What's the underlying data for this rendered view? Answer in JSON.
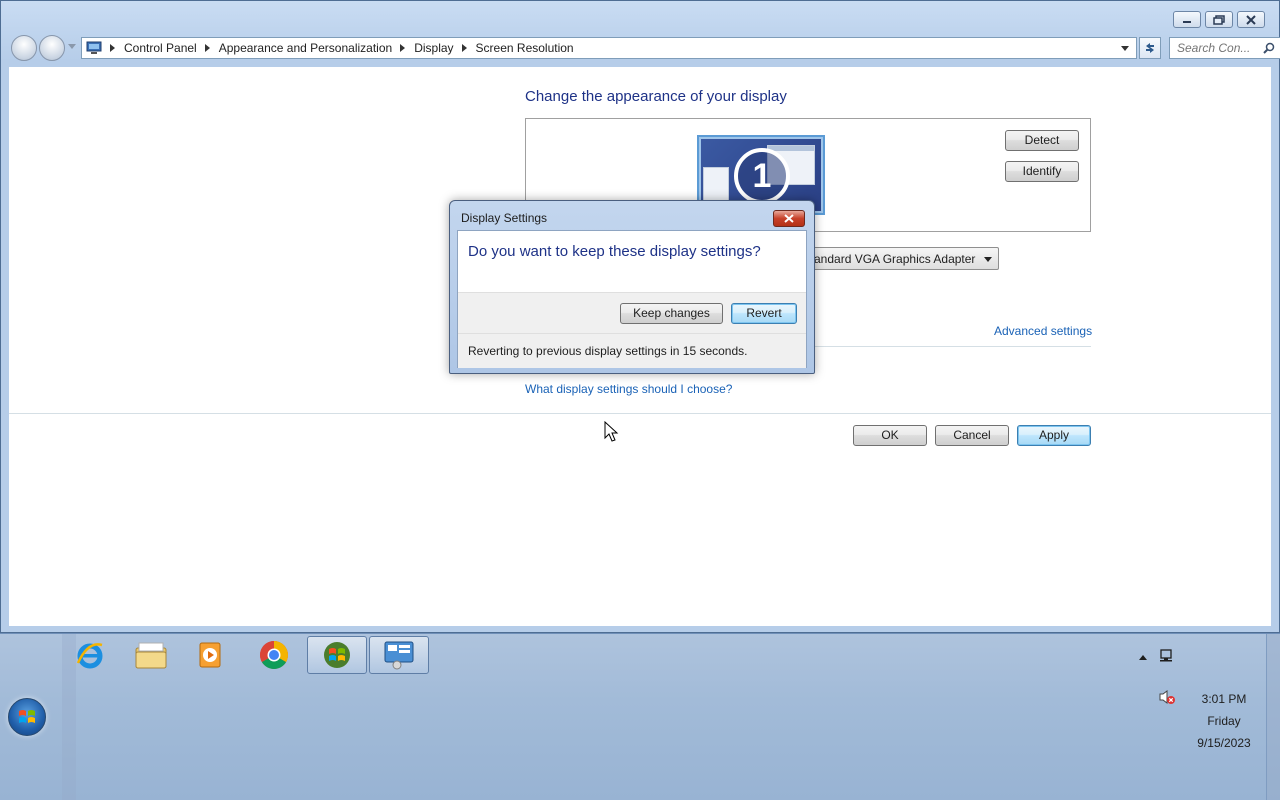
{
  "window": {
    "minimize_label": "",
    "breadcrumbs": [
      "Control Panel",
      "Appearance and Personalization",
      "Display",
      "Screen Resolution"
    ],
    "search_placeholder": "Search Con..."
  },
  "main": {
    "heading": "Change the appearance of your display",
    "monitor_number": "1",
    "detect_label": "Detect",
    "identify_label": "Identify",
    "display_select_value": "andard VGA Graphics Adapter",
    "advanced_link": "Advanced settings",
    "help_link": "What display settings should I choose?",
    "ok_label": "OK",
    "cancel_label": "Cancel",
    "apply_label": "Apply"
  },
  "dialog": {
    "title": "Display Settings",
    "question": "Do you want to keep these display settings?",
    "keep_label": "Keep changes",
    "revert_label": "Revert",
    "status": "Reverting to previous display settings in 15 seconds."
  },
  "taskbar": {
    "pinned": [
      "internet-explorer-icon",
      "file-explorer-icon",
      "media-player-icon",
      "chrome-icon",
      "windows-logo-icon",
      "control-panel-icon"
    ],
    "clock_time": "3:01 PM",
    "clock_day": "Friday",
    "clock_date": "9/15/2023"
  },
  "colors": {
    "heading_blue": "#1e3287",
    "link_blue": "#1a62b6",
    "close_red": "#c7412a"
  }
}
